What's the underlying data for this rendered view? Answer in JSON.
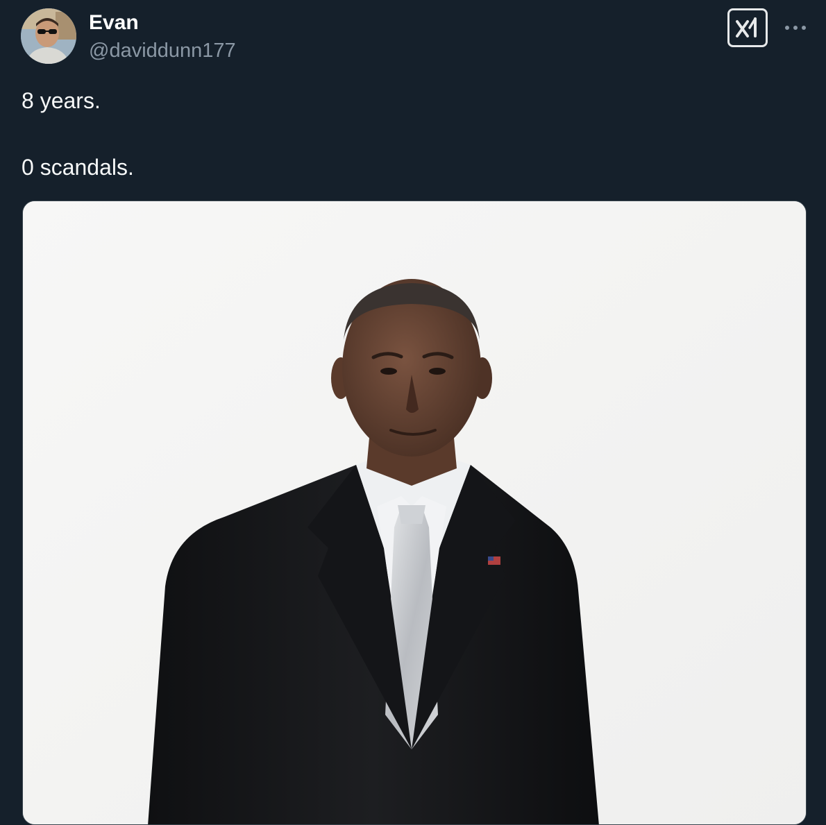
{
  "post": {
    "author": {
      "name": "Evan",
      "handle": "@daviddunn177",
      "avatar_icon": "avatar-photo"
    },
    "text_lines": [
      "8 years.",
      "0 scandals."
    ],
    "header_buttons": {
      "xai_icon": "xai-logo-icon",
      "more_icon": "more-horizontal-icon"
    },
    "media": {
      "type": "photo",
      "background_color": "#f6f6f5"
    }
  },
  "theme": {
    "background": "#15202b",
    "text_primary": "#f7f9f9",
    "text_secondary": "#8b98a5",
    "border": "#38444d"
  }
}
